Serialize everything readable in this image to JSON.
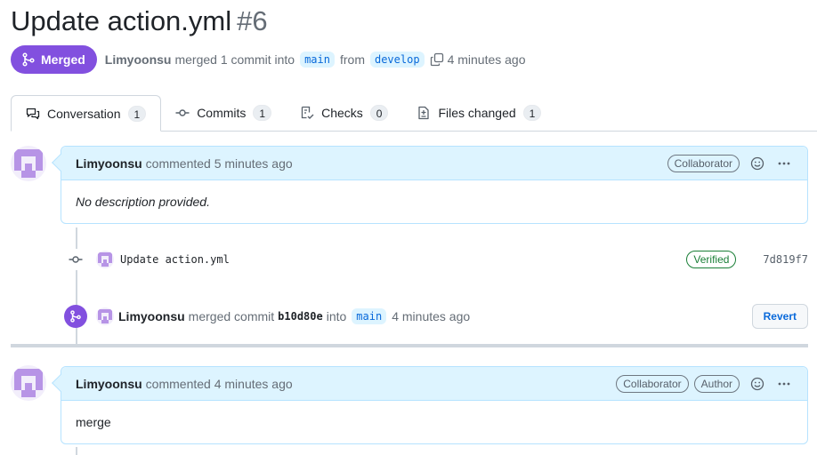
{
  "pr": {
    "title": "Update action.yml",
    "number": "#6",
    "state": "Merged",
    "author": "Limyoonsu",
    "merge_text_1": "merged 1 commit into",
    "base_branch": "main",
    "from_text": "from",
    "head_branch": "develop",
    "time": "4 minutes ago"
  },
  "tabs": [
    {
      "label": "Conversation",
      "count": "1",
      "icon": "comment-discussion-icon"
    },
    {
      "label": "Commits",
      "count": "1",
      "icon": "commit-icon"
    },
    {
      "label": "Checks",
      "count": "0",
      "icon": "checklist-icon"
    },
    {
      "label": "Files changed",
      "count": "1",
      "icon": "file-diff-icon"
    }
  ],
  "comment1": {
    "author": "Limyoonsu",
    "meta": "commented 5 minutes ago",
    "label": "Collaborator",
    "body": "No description provided."
  },
  "commit": {
    "message": "Update action.yml",
    "verified": "Verified",
    "sha": "7d819f7"
  },
  "merge_event": {
    "author": "Limyoonsu",
    "text": "merged commit",
    "sha": "b10d80e",
    "into": "into",
    "branch": "main",
    "time": "4 minutes ago",
    "revert": "Revert"
  },
  "comment2": {
    "author": "Limyoonsu",
    "meta": "commented 4 minutes ago",
    "label1": "Collaborator",
    "label2": "Author",
    "body": "merge"
  },
  "colors": {
    "merged": "#8250df",
    "link": "#0969da",
    "verified": "#1a7f37",
    "comment_header": "#ddf4ff"
  }
}
